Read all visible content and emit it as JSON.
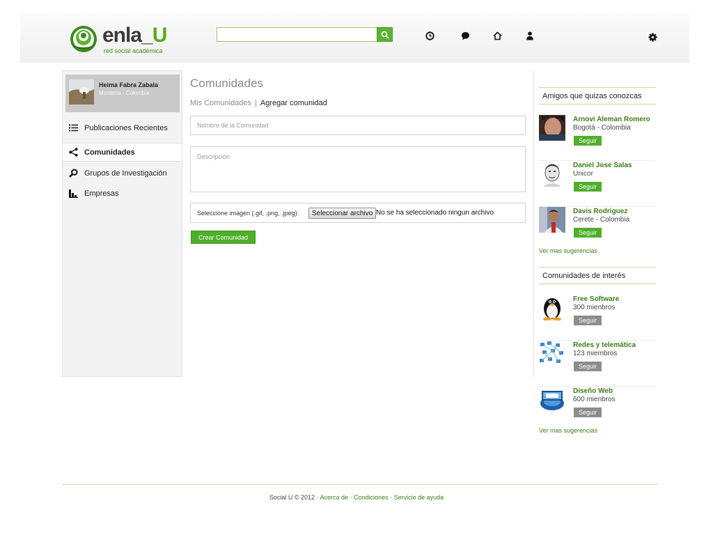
{
  "header": {
    "logo": {
      "name_dark": "enla_",
      "name_green": "U",
      "tagline": "red social académica"
    },
    "search": {
      "value": "",
      "placeholder": ""
    },
    "nav_icons": [
      "clock-icon",
      "chat-bubble-icon",
      "home-icon",
      "user-icon",
      "gear-icon"
    ]
  },
  "profile": {
    "name": "Heima Fabra Zabala",
    "location": "Montería - Colombia"
  },
  "sidebar": {
    "items": [
      {
        "label": "Publicaciones Recientes",
        "icon": "list-icon",
        "active": false
      },
      {
        "label": "Comunidades",
        "icon": "share-icon",
        "active": true
      },
      {
        "label": "Grupos de Investigación",
        "icon": "magnifier-icon",
        "active": false
      },
      {
        "label": "Empresas",
        "icon": "bar-chart-icon",
        "active": false
      }
    ]
  },
  "main": {
    "title": "Comunidades",
    "tabs": [
      {
        "label": "Mis Comunidades"
      },
      {
        "label": "Agregar comunidad"
      }
    ],
    "tab_separator": "|",
    "form": {
      "name_placeholder": "Nombre de la Comunidad",
      "description_placeholder": "Descripción",
      "image_label": "Seleccione imagen (.gif, .png, .jpeg):",
      "file_button": "Seleccionar archivo",
      "file_status": "No se ha seleccionado ningun archivo",
      "submit": "Crear Comunidad"
    }
  },
  "right": {
    "friends": {
      "heading": "Amigos que quizas conozcas",
      "people": [
        {
          "name": "Arnovi Aleman Romero",
          "sub": "Bogotá - Colombia",
          "follow": "Seguir"
        },
        {
          "name": "Daniel Jose Salas",
          "sub": "Unicor",
          "follow": "Seguir"
        },
        {
          "name": "Davis Rodriguez",
          "sub": "Cerete  - Colombia",
          "follow": "Seguir"
        }
      ],
      "more": "Ver mas sugerencias"
    },
    "communities": {
      "heading": "Comunidades de interés",
      "items": [
        {
          "name": "Free Software",
          "sub": "300 mienbros",
          "follow": "Seguir"
        },
        {
          "name": "Redes y telemática",
          "sub": "123 miembros",
          "follow": "Seguir"
        },
        {
          "name": "Diseño Web",
          "sub": "600 mienbros",
          "follow": "Seguir"
        }
      ],
      "more": "Ver mas sugerencias"
    }
  },
  "footer": {
    "copyright": "Social U © 2012 ·",
    "links": [
      "Acerca de",
      "Condiciones",
      "Servicio de ayuda"
    ],
    "separator": "·"
  },
  "colors": {
    "brand_green": "#4fae2a",
    "link_green": "#3d7d18",
    "divider_green": "#c9d7a8"
  }
}
